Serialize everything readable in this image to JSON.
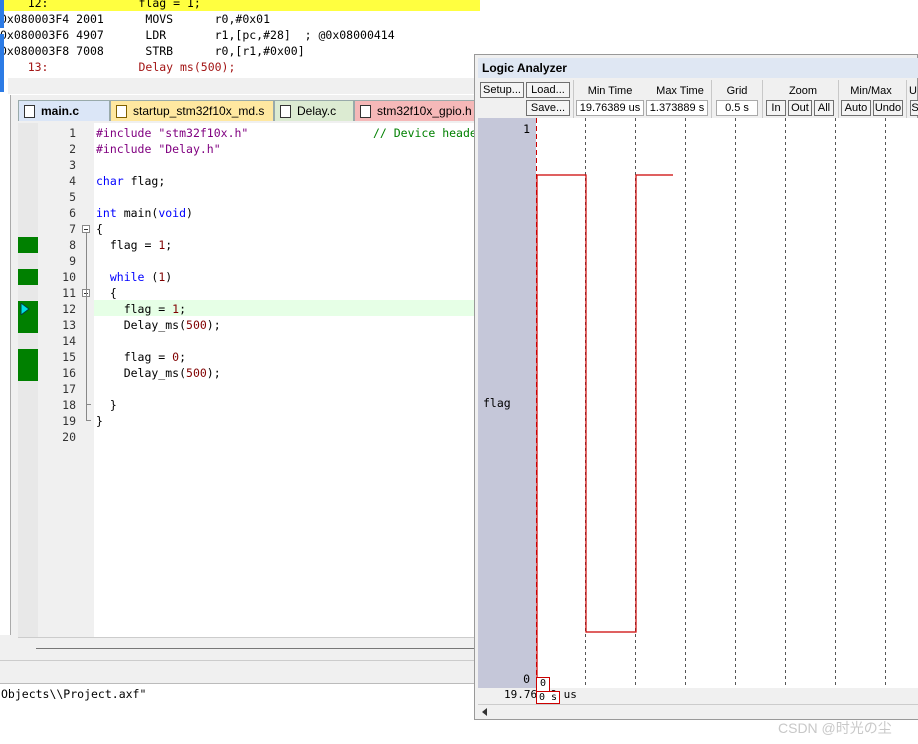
{
  "disassembly": {
    "lines": [
      {
        "text": "    12:             flag = 1;",
        "highlight": true
      },
      {
        "text": "0x080003F4 2001      MOVS      r0,#0x01",
        "highlight": false
      },
      {
        "text": "0x080003F6 4907      LDR       r1,[pc,#28]  ; @0x08000414",
        "highlight": false
      },
      {
        "text": "0x080003F8 7008      STRB      r0,[r1,#0x00]",
        "highlight": false
      },
      {
        "text": "    13:             Delay ms(500);",
        "highlight": false
      }
    ]
  },
  "editor": {
    "tabs": [
      {
        "label": "main.c",
        "bg": "#dbe6f7",
        "bold": true
      },
      {
        "label": "startup_stm32f10x_md.s",
        "bg": "#ffe8a0",
        "bold": false
      },
      {
        "label": "Delay.c",
        "bg": "#dcebd2",
        "bold": false
      },
      {
        "label": "stm32f10x_gpio.h",
        "bg": "#f5b8b8",
        "bold": false
      }
    ],
    "line_numbers": [
      "1",
      "2",
      "3",
      "4",
      "5",
      "6",
      "7",
      "8",
      "9",
      "10",
      "11",
      "12",
      "13",
      "14",
      "15",
      "16",
      "17",
      "18",
      "19",
      "20"
    ],
    "code": {
      "l1_kw": "#include",
      "l1_str": "\"stm32f10x.h\"",
      "l1_cm": "// Device header",
      "l2_kw": "#include",
      "l2_str": "\"Delay.h\"",
      "l4_kw": "char",
      "l4_rest": " flag;",
      "l6_kw": "int",
      "l6_mid": " main(",
      "l6_kw2": "void",
      "l6_end": ")",
      "l7": "{",
      "l8_a": "  flag = ",
      "l8_num": "1",
      "l8_b": ";",
      "l10_kw": "  while",
      "l10_a": " (",
      "l10_num": "1",
      "l10_b": ")",
      "l11": "  {",
      "l12_a": "    flag = ",
      "l12_num": "1",
      "l12_b": ";",
      "l13_a": "    Delay_ms(",
      "l13_num": "500",
      "l13_b": ");",
      "l15_a": "    flag = ",
      "l15_num": "0",
      "l15_b": ";",
      "l16_a": "    Delay_ms(",
      "l16_num": "500",
      "l16_b": ");",
      "l18": "  }",
      "l19": "}"
    }
  },
  "output": {
    "text": "Objects\\\\Project.axf\""
  },
  "logic_analyzer": {
    "title": "Logic Analyzer",
    "buttons": {
      "setup": "Setup...",
      "load": "Load...",
      "save": "Save...",
      "zoom_in": "In",
      "zoom_out": "Out",
      "zoom_all": "All",
      "auto": "Auto",
      "undo": "Undo",
      "cut_u": "U",
      "cut_s": "S"
    },
    "labels": {
      "min_time": "Min Time",
      "max_time": "Max Time",
      "grid": "Grid",
      "zoom": "Zoom",
      "minmax": "Min/Max"
    },
    "values": {
      "min_time": "19.76389 us",
      "max_time": "1.373889 s",
      "grid": "0.5 s"
    },
    "signal": {
      "name": "flag",
      "y_max": "1",
      "y_min": "0",
      "waveform_color": "#cc0000"
    },
    "bottom": {
      "left_time": "19.76389 us",
      "cursor_box": "0",
      "cursor_time": "0 s"
    }
  },
  "watermark": "CSDN @时光の尘"
}
